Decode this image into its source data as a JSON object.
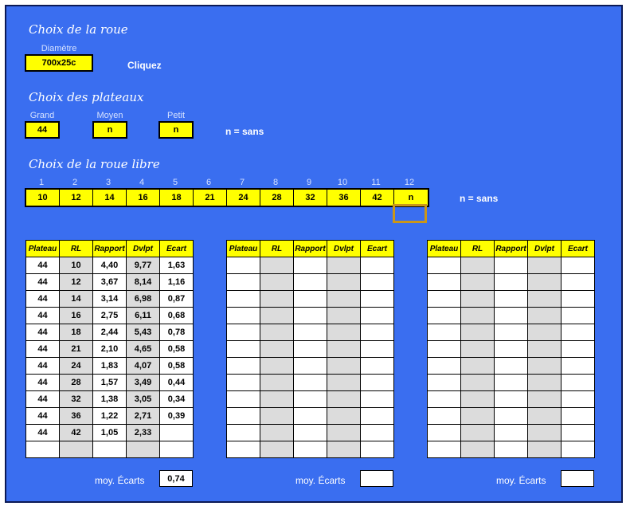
{
  "sections": {
    "roue": "Choix de la roue",
    "plateaux": "Choix des plateaux",
    "roue_libre": "Choix de la roue libre"
  },
  "wheel": {
    "label": "Diamètre",
    "value": "700x25c",
    "click_label": "Cliquez"
  },
  "plateaux": {
    "grand_label": "Grand",
    "grand_value": "44",
    "moyen_label": "Moyen",
    "moyen_value": "n",
    "petit_label": "Petit",
    "petit_value": "n",
    "note": "n = sans"
  },
  "roue_libre": {
    "indices": [
      "1",
      "2",
      "3",
      "4",
      "5",
      "6",
      "7",
      "8",
      "9",
      "10",
      "11",
      "12"
    ],
    "values": [
      "10",
      "12",
      "14",
      "16",
      "18",
      "21",
      "24",
      "28",
      "32",
      "36",
      "42",
      "n"
    ],
    "note": "n = sans"
  },
  "table_headers": [
    "Plateau",
    "RL",
    "Rapport",
    "Dvlpt",
    "Ecart"
  ],
  "tables": [
    {
      "rows": [
        [
          "44",
          "10",
          "4,40",
          "9,77",
          "1,63"
        ],
        [
          "44",
          "12",
          "3,67",
          "8,14",
          "1,16"
        ],
        [
          "44",
          "14",
          "3,14",
          "6,98",
          "0,87"
        ],
        [
          "44",
          "16",
          "2,75",
          "6,11",
          "0,68"
        ],
        [
          "44",
          "18",
          "2,44",
          "5,43",
          "0,78"
        ],
        [
          "44",
          "21",
          "2,10",
          "4,65",
          "0,58"
        ],
        [
          "44",
          "24",
          "1,83",
          "4,07",
          "0,58"
        ],
        [
          "44",
          "28",
          "1,57",
          "3,49",
          "0,44"
        ],
        [
          "44",
          "32",
          "1,38",
          "3,05",
          "0,34"
        ],
        [
          "44",
          "36",
          "1,22",
          "2,71",
          "0,39"
        ],
        [
          "44",
          "42",
          "1,05",
          "2,33",
          ""
        ],
        [
          "",
          "",
          "",
          "",
          ""
        ]
      ],
      "moy_label": "moy. Écarts",
      "moy_value": "0,74"
    },
    {
      "rows": [
        [
          "",
          "",
          "",
          "",
          ""
        ],
        [
          "",
          "",
          "",
          "",
          ""
        ],
        [
          "",
          "",
          "",
          "",
          ""
        ],
        [
          "",
          "",
          "",
          "",
          ""
        ],
        [
          "",
          "",
          "",
          "",
          ""
        ],
        [
          "",
          "",
          "",
          "",
          ""
        ],
        [
          "",
          "",
          "",
          "",
          ""
        ],
        [
          "",
          "",
          "",
          "",
          ""
        ],
        [
          "",
          "",
          "",
          "",
          ""
        ],
        [
          "",
          "",
          "",
          "",
          ""
        ],
        [
          "",
          "",
          "",
          "",
          ""
        ],
        [
          "",
          "",
          "",
          "",
          ""
        ]
      ],
      "moy_label": "moy. Écarts",
      "moy_value": ""
    },
    {
      "rows": [
        [
          "",
          "",
          "",
          "",
          ""
        ],
        [
          "",
          "",
          "",
          "",
          ""
        ],
        [
          "",
          "",
          "",
          "",
          ""
        ],
        [
          "",
          "",
          "",
          "",
          ""
        ],
        [
          "",
          "",
          "",
          "",
          ""
        ],
        [
          "",
          "",
          "",
          "",
          ""
        ],
        [
          "",
          "",
          "",
          "",
          ""
        ],
        [
          "",
          "",
          "",
          "",
          ""
        ],
        [
          "",
          "",
          "",
          "",
          ""
        ],
        [
          "",
          "",
          "",
          "",
          ""
        ],
        [
          "",
          "",
          "",
          "",
          ""
        ],
        [
          "",
          "",
          "",
          "",
          ""
        ]
      ],
      "moy_label": "moy. Écarts",
      "moy_value": ""
    }
  ]
}
